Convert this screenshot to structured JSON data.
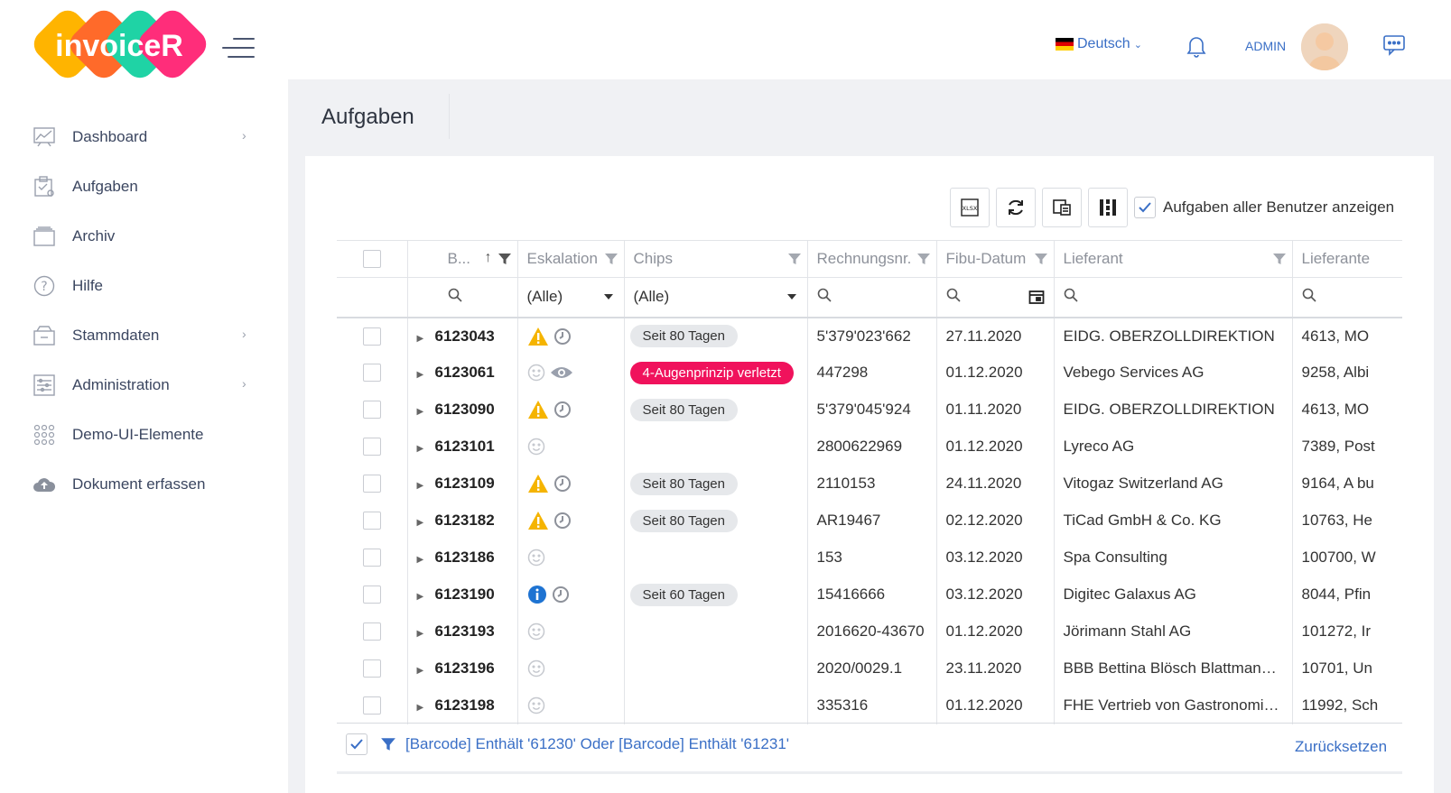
{
  "app": {
    "logo_text": "invoiceR"
  },
  "header": {
    "language": "Deutsch",
    "user": "ADMIN"
  },
  "sidebar": {
    "items": [
      {
        "label": "Dashboard",
        "icon": "chart-icon",
        "has_children": true
      },
      {
        "label": "Aufgaben",
        "icon": "tasks-icon",
        "has_children": false
      },
      {
        "label": "Archiv",
        "icon": "archive-icon",
        "has_children": false
      },
      {
        "label": "Hilfe",
        "icon": "help-icon",
        "has_children": false
      },
      {
        "label": "Stammdaten",
        "icon": "database-icon",
        "has_children": true
      },
      {
        "label": "Administration",
        "icon": "admin-icon",
        "has_children": true
      },
      {
        "label": "Demo-UI-Elemente",
        "icon": "grid-dots-icon",
        "has_children": false
      },
      {
        "label": "Dokument erfassen",
        "icon": "cloud-upload-icon",
        "has_children": false
      }
    ]
  },
  "page": {
    "title": "Aufgaben"
  },
  "toolbar": {
    "show_all_label": "Aufgaben aller Benutzer anzeigen",
    "show_all_checked": true
  },
  "grid": {
    "columns": [
      "B...",
      "Eskalation",
      "Chips",
      "Rechnungsnr.",
      "Fibu-Datum",
      "Lieferant",
      "Lieferante"
    ],
    "filters": {
      "eskalation": "(Alle)",
      "chips": "(Alle)"
    },
    "rows": [
      {
        "barcode": "6123043",
        "esc": "warn-clock",
        "chip": "Seit 80 Tagen",
        "chip_type": "grey",
        "rechnung": "5'379'023'662",
        "datum": "27.11.2020",
        "lieferant": "EIDG. OBERZOLLDIREKTION",
        "adresse": "4613, MO"
      },
      {
        "barcode": "6123061",
        "esc": "smile-eye",
        "chip": "4-Augenprinzip verletzt",
        "chip_type": "red",
        "rechnung": "447298",
        "datum": "01.12.2020",
        "lieferant": "Vebego Services AG",
        "adresse": "9258, Albi"
      },
      {
        "barcode": "6123090",
        "esc": "warn-clock",
        "chip": "Seit 80 Tagen",
        "chip_type": "grey",
        "rechnung": "5'379'045'924",
        "datum": "01.11.2020",
        "lieferant": "EIDG. OBERZOLLDIREKTION",
        "adresse": "4613, MO"
      },
      {
        "barcode": "6123101",
        "esc": "smile",
        "chip": "",
        "chip_type": "",
        "rechnung": "2800622969",
        "datum": "01.12.2020",
        "lieferant": "Lyreco AG",
        "adresse": "7389, Post"
      },
      {
        "barcode": "6123109",
        "esc": "warn-clock",
        "chip": "Seit 80 Tagen",
        "chip_type": "grey",
        "rechnung": "2110153",
        "datum": "24.11.2020",
        "lieferant": "Vitogaz Switzerland AG",
        "adresse": "9164, A bu"
      },
      {
        "barcode": "6123182",
        "esc": "warn-clock",
        "chip": "Seit 80 Tagen",
        "chip_type": "grey",
        "rechnung": "AR19467",
        "datum": "02.12.2020",
        "lieferant": "TiCad GmbH & Co. KG",
        "adresse": "10763, He"
      },
      {
        "barcode": "6123186",
        "esc": "smile",
        "chip": "",
        "chip_type": "",
        "rechnung": "153",
        "datum": "03.12.2020",
        "lieferant": "Spa Consulting",
        "adresse": "100700, W"
      },
      {
        "barcode": "6123190",
        "esc": "info-clock",
        "chip": "Seit 60 Tagen",
        "chip_type": "grey",
        "rechnung": "15416666",
        "datum": "03.12.2020",
        "lieferant": "Digitec Galaxus AG",
        "adresse": "8044, Pfin"
      },
      {
        "barcode": "6123193",
        "esc": "smile",
        "chip": "",
        "chip_type": "",
        "rechnung": "2016620-43670",
        "datum": "01.12.2020",
        "lieferant": "Jörimann Stahl AG",
        "adresse": "101272, Ir"
      },
      {
        "barcode": "6123196",
        "esc": "smile",
        "chip": "",
        "chip_type": "",
        "rechnung": "2020/0029.1",
        "datum": "23.11.2020",
        "lieferant": "BBB Bettina Blösch Blattmann ...",
        "adresse": "10701, Un"
      },
      {
        "barcode": "6123198",
        "esc": "smile",
        "chip": "",
        "chip_type": "",
        "rechnung": "335316",
        "datum": "01.12.2020",
        "lieferant": "FHE Vertrieb von Gastronomie...",
        "adresse": "11992, Sch"
      }
    ]
  },
  "filter_bar": {
    "expression": "[Barcode] Enthält '61230' Oder [Barcode] Enthält '61231'",
    "reset_label": "Zurücksetzen",
    "enabled": true
  },
  "colors": {
    "accent": "#3a6fc6",
    "chip_red": "#f0125c",
    "warn": "#f5b400",
    "info": "#1e73d2"
  }
}
